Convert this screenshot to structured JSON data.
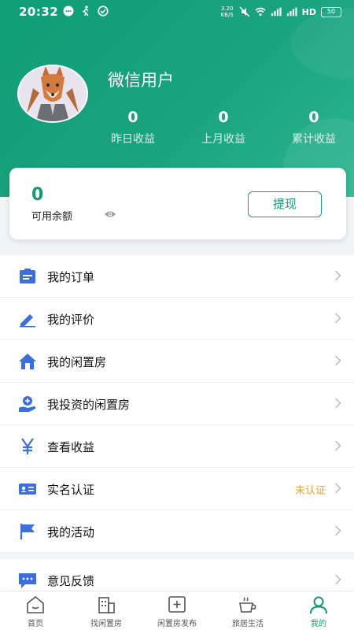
{
  "status_bar": {
    "time": "20:32",
    "network_speed": "3.20 KB/S",
    "network_type": "HD",
    "battery": "50"
  },
  "profile": {
    "username": "微信用户",
    "stats": [
      {
        "value": "0",
        "label": "昨日收益"
      },
      {
        "value": "0",
        "label": "上月收益"
      },
      {
        "value": "0",
        "label": "累计收益"
      }
    ]
  },
  "balance": {
    "amount": "0",
    "label": "可用余额",
    "withdraw_label": "提现"
  },
  "menu": [
    {
      "label": "我的订单",
      "icon": "order-icon"
    },
    {
      "label": "我的评价",
      "icon": "edit-icon"
    },
    {
      "label": "我的闲置房",
      "icon": "house-icon"
    },
    {
      "label": "我投资的闲置房",
      "icon": "investment-icon"
    },
    {
      "label": "查看收益",
      "icon": "yen-icon"
    },
    {
      "label": "实名认证",
      "icon": "id-card-icon",
      "status": "未认证"
    },
    {
      "label": "我的活动",
      "icon": "flag-icon"
    }
  ],
  "menu_extra": [
    {
      "label": "意见反馈",
      "icon": "feedback-icon"
    }
  ],
  "tabs": [
    {
      "label": "首页",
      "icon": "home-icon"
    },
    {
      "label": "找闲置房",
      "icon": "building-icon"
    },
    {
      "label": "闲置房发布",
      "icon": "add-icon"
    },
    {
      "label": "旅居生活",
      "icon": "cup-icon"
    },
    {
      "label": "我的",
      "icon": "user-icon",
      "active": true
    }
  ],
  "colors": {
    "brand_green": "#12a07a",
    "status_orange": "#e8a51e",
    "icon_blue": "#3b6fe0"
  }
}
